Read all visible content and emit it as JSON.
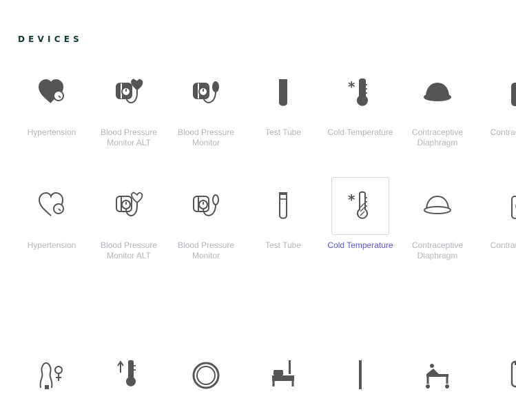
{
  "section": {
    "title": "DEVICES"
  },
  "colors": {
    "icon": "#555555",
    "label": "#b5b5bd",
    "selected_label": "#5757d8",
    "title": "#0e3b39"
  },
  "rows": [
    {
      "style": "filled",
      "items": [
        {
          "icon": "hypertension-icon",
          "label": "Hypertension"
        },
        {
          "icon": "blood-pressure-monitor-alt-icon",
          "label": "Blood Pressure Monitor ALT"
        },
        {
          "icon": "blood-pressure-monitor-icon",
          "label": "Blood Pressure Monitor"
        },
        {
          "icon": "test-tube-icon",
          "label": "Test Tube"
        },
        {
          "icon": "cold-temperature-icon",
          "label": "Cold Temperature"
        },
        {
          "icon": "contraceptive-diaphragm-icon",
          "label": "Contraceptive Diaphragm"
        },
        {
          "icon": "contraceptive-injection-icon",
          "label": "Contrac Injec"
        }
      ]
    },
    {
      "style": "outline",
      "items": [
        {
          "icon": "hypertension-icon",
          "label": "Hypertension"
        },
        {
          "icon": "blood-pressure-monitor-alt-icon",
          "label": "Blood Pressure Monitor ALT"
        },
        {
          "icon": "blood-pressure-monitor-icon",
          "label": "Blood Pressure Monitor"
        },
        {
          "icon": "test-tube-icon",
          "label": "Test Tube"
        },
        {
          "icon": "cold-temperature-icon",
          "label": "Cold Temperature",
          "selected": true
        },
        {
          "icon": "contraceptive-diaphragm-icon",
          "label": "Contraceptive Diaphragm"
        },
        {
          "icon": "contraceptive-injection-icon",
          "label": "Contrac Injec"
        }
      ]
    },
    {
      "style": "filled",
      "items": [
        {
          "icon": "fertility-icon"
        },
        {
          "icon": "fever-rising-icon"
        },
        {
          "icon": "ring-icon"
        },
        {
          "icon": "hospital-bed-icon"
        },
        {
          "icon": "needle-icon"
        },
        {
          "icon": "stretcher-icon"
        },
        {
          "icon": "device-icon"
        }
      ]
    }
  ]
}
